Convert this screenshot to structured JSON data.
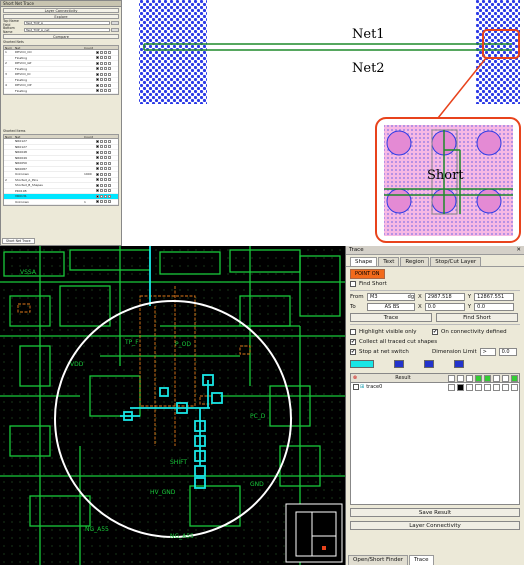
{
  "left_panel": {
    "title": "Short Net Trace",
    "layer_connectivity": "Layer Connectivity",
    "explore": "Explore",
    "top_name_field_label": "Top Name Field",
    "top_name_field_value": "Test_TOP_A",
    "bottom_name_field_label": "Bottom Name",
    "bottom_name_field_value": "Test_TOP_A_net",
    "compare": "Compare",
    "shorted_nets": "Shorted Nets",
    "table1": {
      "headers": [
        "Num",
        "Net",
        "Count",
        ""
      ],
      "rows": [
        {
          "num": "1",
          "net": "DEVCO_CO",
          "count": "",
          "sel": false
        },
        {
          "num": "",
          "net": "Floating",
          "count": "",
          "sel": false
        },
        {
          "num": "2",
          "net": "DEVCO_GP",
          "count": "",
          "sel": false
        },
        {
          "num": "",
          "net": "Floating",
          "count": "",
          "sel": false
        },
        {
          "num": "3",
          "net": "DEVCO_IO",
          "count": "",
          "sel": false
        },
        {
          "num": "",
          "net": "Floating",
          "count": "",
          "sel": false
        },
        {
          "num": "4",
          "net": "DEVCO_OP",
          "count": "",
          "sel": false
        },
        {
          "num": "",
          "net": "Floating",
          "count": "",
          "sel": false
        }
      ]
    },
    "shorted_items": "Shorted Items",
    "table2": {
      "headers": [
        "Num",
        "Net",
        "Count",
        ""
      ],
      "rows": [
        {
          "num": "",
          "net": "NR0127",
          "count": "",
          "sel": false
        },
        {
          "num": "",
          "net": "NR0127",
          "count": "",
          "sel": false
        },
        {
          "num": "",
          "net": "NR0048",
          "count": "",
          "sel": false
        },
        {
          "num": "",
          "net": "NR0049",
          "count": "",
          "sel": false
        },
        {
          "num": "",
          "net": "NR0050",
          "count": "",
          "sel": false
        },
        {
          "num": "",
          "net": "NR0087",
          "count": "",
          "sel": false
        },
        {
          "num": "",
          "net": "Unknown",
          "count": "1900",
          "sel": false
        },
        {
          "num": "2",
          "net": "Shorted_A_Pins",
          "count": "",
          "sel": false
        },
        {
          "num": "",
          "net": "Shorted_B_Shapes",
          "count": "",
          "sel": false
        },
        {
          "num": "",
          "net": "PR0198",
          "count": "",
          "sel": false
        },
        {
          "num": "",
          "net": "VR0131",
          "count": "",
          "sel": true
        },
        {
          "num": "",
          "net": "Unknown",
          "count": "1",
          "sel": false
        }
      ]
    },
    "bottom_tab": "Short Net Trace"
  },
  "illustration": {
    "net1": "Net1",
    "net2": "Net2",
    "short": "Short",
    "colors": {
      "dots": "#2d3be6",
      "net": "#1f8a2a",
      "callout": "#e8431c",
      "pink": "#f29ad8"
    }
  },
  "canvas": {
    "labels": [
      "VSSA",
      "VDD",
      "TP_F",
      "P_OD",
      "HV_GND",
      "NG_A55",
      "NG_A55",
      "SHIFT",
      "GND",
      "PC_D"
    ],
    "colors": {
      "green": "#18c93a",
      "cyan": "#19e6e6",
      "orange": "#e07a1a",
      "white": "#ffffff"
    }
  },
  "trace_panel": {
    "title": "Trace",
    "tabs": [
      "Shape",
      "Text",
      "Region",
      "Stop/Cut Layer"
    ],
    "on_button": "POINT ON",
    "find_short": "Find Short",
    "from_label": "From",
    "from_layer": "M3",
    "from_layer_suffix": "dg",
    "from_x": "2987.518",
    "from_y": "12867.551",
    "to_label": "To",
    "to_layer": "AS BS",
    "to_x": "0.0",
    "to_y": "0.0",
    "x_label": "X",
    "y_label": "Y",
    "trace_button": "Trace",
    "find_short_button": "Find Short",
    "highlight_visible": "Highlight visible only",
    "on_connectivity": "On connectivity defined",
    "collect_traced": "Collect all traced cut shapes",
    "stop_at_net": "Stop at net switch",
    "dimension_limit": "Dimension Limit",
    "dimension_op": ">",
    "dimension_value": "0.0",
    "result_header": "Result",
    "result_rows": [
      "trace0"
    ],
    "save_result": "Save Result",
    "layer_connectivity": "Layer Connectivity",
    "bottom_tabs": [
      "Open/Short Finder",
      "Trace"
    ]
  }
}
